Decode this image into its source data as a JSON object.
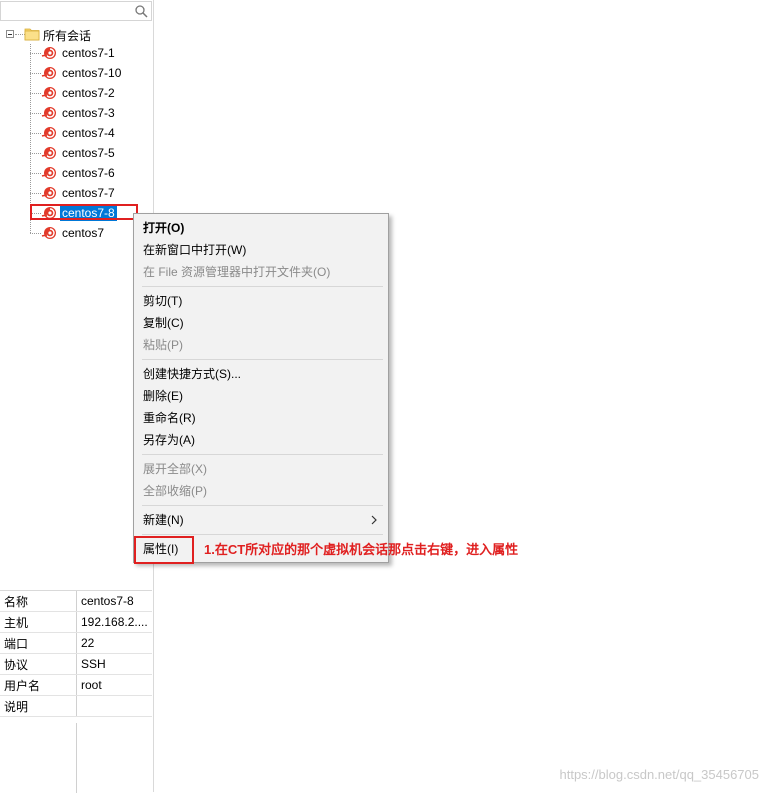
{
  "search": {
    "placeholder": ""
  },
  "tree": {
    "root_label": "所有会话",
    "sessions": [
      {
        "label": "centos7-1"
      },
      {
        "label": "centos7-10"
      },
      {
        "label": "centos7-2"
      },
      {
        "label": "centos7-3"
      },
      {
        "label": "centos7-4"
      },
      {
        "label": "centos7-5"
      },
      {
        "label": "centos7-6"
      },
      {
        "label": "centos7-7"
      },
      {
        "label": "centos7-8"
      },
      {
        "label": "centos7"
      }
    ],
    "selected_index": 8
  },
  "properties": [
    {
      "key": "名称",
      "value": "centos7-8"
    },
    {
      "key": "主机",
      "value": "192.168.2...."
    },
    {
      "key": "端口",
      "value": "22"
    },
    {
      "key": "协议",
      "value": "SSH"
    },
    {
      "key": "用户名",
      "value": "root"
    },
    {
      "key": "说明",
      "value": ""
    }
  ],
  "context_menu": {
    "items": [
      {
        "label": "打开(O)",
        "bold": true,
        "disabled": false
      },
      {
        "label": "在新窗口中打开(W)",
        "disabled": false
      },
      {
        "label": "在 File 资源管理器中打开文件夹(O)",
        "disabled": true
      },
      {
        "label": "剪切(T)",
        "disabled": false
      },
      {
        "label": "复制(C)",
        "disabled": false
      },
      {
        "label": "粘贴(P)",
        "disabled": true
      },
      {
        "label": "创建快捷方式(S)...",
        "disabled": false
      },
      {
        "label": "删除(E)",
        "disabled": false
      },
      {
        "label": "重命名(R)",
        "disabled": false
      },
      {
        "label": "另存为(A)",
        "disabled": false
      },
      {
        "label": "展开全部(X)",
        "disabled": true
      },
      {
        "label": "全部收缩(P)",
        "disabled": true
      },
      {
        "label": "新建(N)",
        "disabled": false,
        "submenu": true
      },
      {
        "label": "属性(I)",
        "disabled": false
      }
    ]
  },
  "annotation": {
    "text": "1.在CT所对应的那个虚拟机会话那点击右键，进入属性"
  },
  "watermark": {
    "text": "https://blog.csdn.net/qq_35456705"
  },
  "colors": {
    "selection": "#0078d7",
    "annotation_red": "#e02020",
    "session_icon": "#e23a2a",
    "folder": "#f5d36b"
  }
}
